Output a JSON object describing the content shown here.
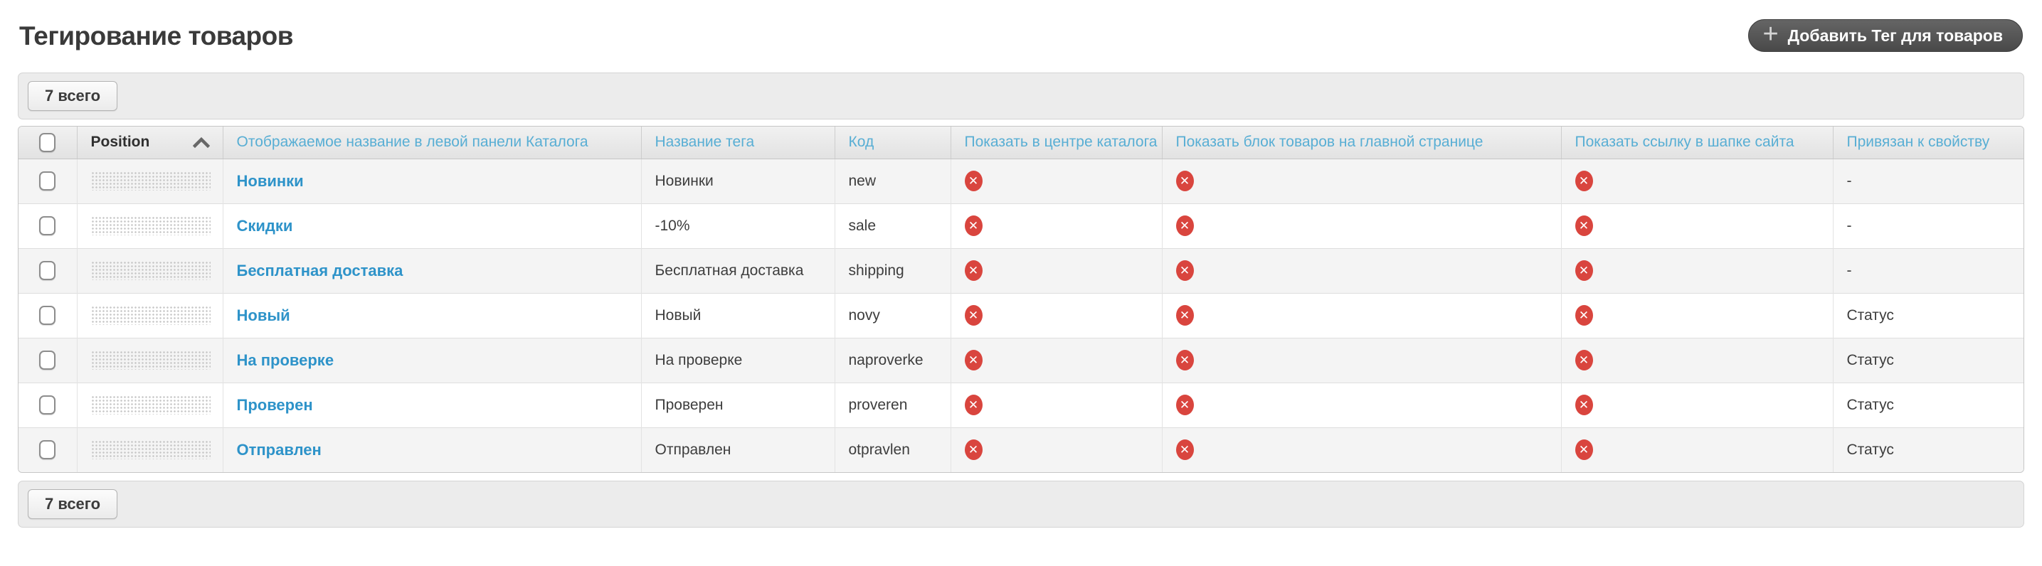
{
  "header": {
    "title": "Тегирование товаров",
    "add_button": {
      "label": "Добавить Тег для товаров"
    }
  },
  "pagination": {
    "total_label": "7 всего"
  },
  "footer": {
    "total_label": "7 всего"
  },
  "icons": {
    "plus_glyph": "+",
    "status_off_glyph": "✕",
    "sort_icon": "chevron-up-icon"
  },
  "colors": {
    "accent_blue": "#2e93c9",
    "header_blue": "#58aed4",
    "danger_red": "#d9453e",
    "title_gray": "#3a3a3a",
    "bar_bg": "#ececec",
    "row_alt": "#f4f4f4",
    "dark_button": "#4a4a4a"
  },
  "table": {
    "columns": {
      "position": "Position",
      "display_name": "Отображаемое название в левой панели Каталога",
      "tag_name": "Название тега",
      "code": "Код",
      "show_in_catalog_center": "Показать в центре каталога",
      "show_block_on_main": "Показать блок товаров на главной странице",
      "show_link_in_header": "Показать ссылку в шапке сайта",
      "linked_property": "Привязан к свойству"
    },
    "sort": {
      "column": "position",
      "direction": "asc"
    },
    "rows": [
      {
        "display_name": "Новинки",
        "tag_name": "Новинки",
        "code": "new",
        "show_in_catalog_center": false,
        "show_block_on_main": false,
        "show_link_in_header": false,
        "linked_property": "-"
      },
      {
        "display_name": "Скидки",
        "tag_name": "-10%",
        "code": "sale",
        "show_in_catalog_center": false,
        "show_block_on_main": false,
        "show_link_in_header": false,
        "linked_property": "-"
      },
      {
        "display_name": "Бесплатная доставка",
        "tag_name": "Бесплатная доставка",
        "code": "shipping",
        "show_in_catalog_center": false,
        "show_block_on_main": false,
        "show_link_in_header": false,
        "linked_property": "-"
      },
      {
        "display_name": "Новый",
        "tag_name": "Новый",
        "code": "novy",
        "show_in_catalog_center": false,
        "show_block_on_main": false,
        "show_link_in_header": false,
        "linked_property": "Статус"
      },
      {
        "display_name": "На проверке",
        "tag_name": "На проверке",
        "code": "naproverke",
        "show_in_catalog_center": false,
        "show_block_on_main": false,
        "show_link_in_header": false,
        "linked_property": "Статус"
      },
      {
        "display_name": "Проверен",
        "tag_name": "Проверен",
        "code": "proveren",
        "show_in_catalog_center": false,
        "show_block_on_main": false,
        "show_link_in_header": false,
        "linked_property": "Статус"
      },
      {
        "display_name": "Отправлен",
        "tag_name": "Отправлен",
        "code": "otpravlen",
        "show_in_catalog_center": false,
        "show_block_on_main": false,
        "show_link_in_header": false,
        "linked_property": "Статус"
      }
    ]
  }
}
